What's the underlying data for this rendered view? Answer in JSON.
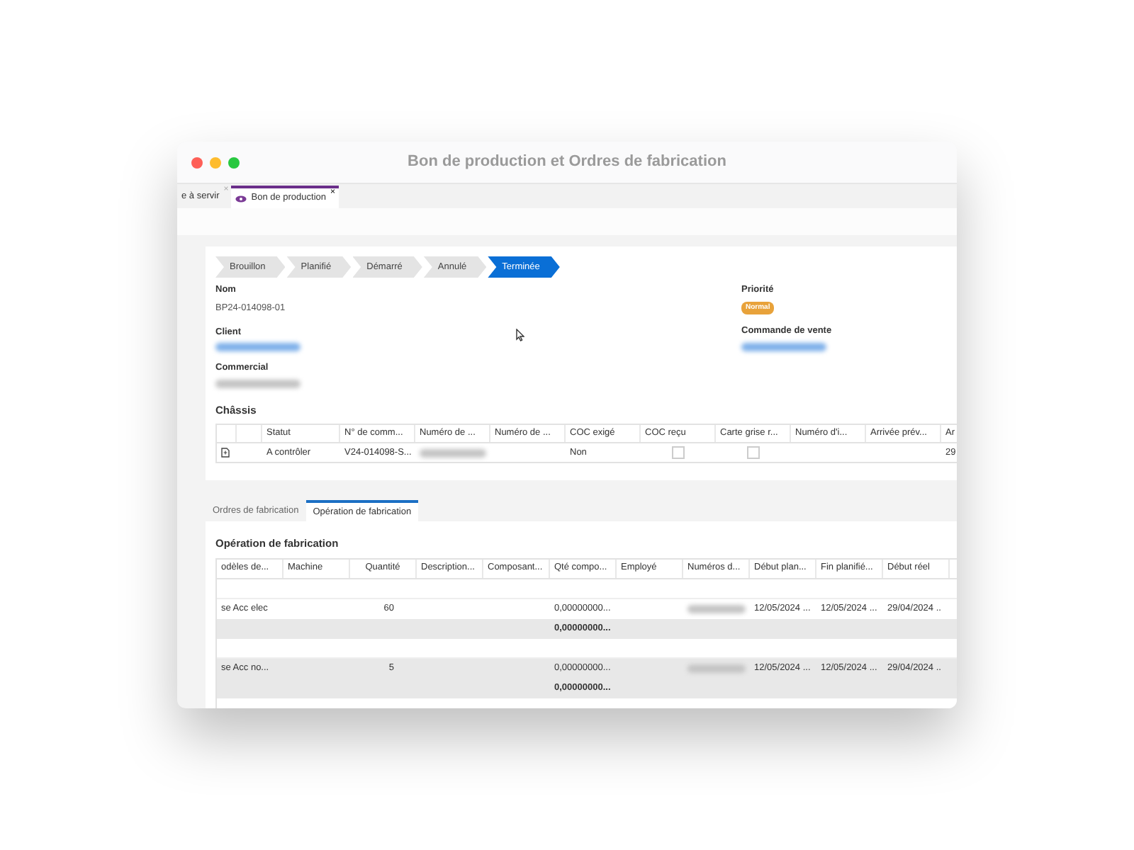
{
  "window": {
    "title": "Bon de production et Ordres de fabrication"
  },
  "tabs": [
    {
      "label": "e à servir",
      "selected": false,
      "close": "×"
    },
    {
      "label": "Bon de production",
      "selected": true,
      "close": "×"
    }
  ],
  "stepper": [
    {
      "label": "Brouillon",
      "selected": false
    },
    {
      "label": "Planifié",
      "selected": false
    },
    {
      "label": "Démarré",
      "selected": false
    },
    {
      "label": "Annulé",
      "selected": false
    },
    {
      "label": "Terminée",
      "selected": true
    }
  ],
  "fields_left": [
    {
      "label": "Nom",
      "kind": "text",
      "value": "BP24-014098-01"
    },
    {
      "label": "Client",
      "kind": "link-blurred"
    },
    {
      "label": "Commercial",
      "kind": "blurred"
    }
  ],
  "fields_right": [
    {
      "label": "Priorité",
      "kind": "badge",
      "value": "Normal"
    },
    {
      "label": "Commande de vente",
      "kind": "link-blurred"
    }
  ],
  "chassis": {
    "title": "Châssis",
    "columns": [
      "",
      "",
      "Statut",
      "N° de comm...",
      "Numéro de ...",
      "Numéro de ...",
      "COC exigé",
      "COC reçu",
      "Carte grise r...",
      "Numéro d'i...",
      "Arrivée prév...",
      "Ar"
    ],
    "rows": [
      [
        {
          "kind": "icon"
        },
        {
          "kind": "text"
        },
        {
          "kind": "text",
          "value": "A contrôler"
        },
        {
          "kind": "text",
          "value": "V24-014098-S..."
        },
        {
          "kind": "blurred"
        },
        {
          "kind": "text"
        },
        {
          "kind": "text",
          "value": "Non"
        },
        {
          "kind": "checkbox",
          "checked": false
        },
        {
          "kind": "checkbox",
          "checked": false
        },
        {
          "kind": "text"
        },
        {
          "kind": "text"
        },
        {
          "kind": "text",
          "value": "29"
        }
      ]
    ]
  },
  "lower_tabs": [
    {
      "label": "Ordres de fabrication",
      "selected": false
    },
    {
      "label": "Opération de fabrication",
      "selected": true
    }
  ],
  "operations": {
    "title": "Opération de fabrication",
    "columns": [
      "odèles de...",
      "Machine",
      "Quantité",
      "Description...",
      "Composant...",
      "Qté compo...",
      "Employé",
      "Numéros d...",
      "Début plan...",
      "Fin planifié...",
      "Début réel"
    ],
    "rows": [
      {
        "kind": "empty"
      },
      {
        "kind": "data",
        "cells": [
          "se Acc elec",
          "",
          "60",
          "",
          "",
          "0,00000000...",
          "",
          null,
          "12/05/2024 ...",
          "12/05/2024 ...",
          "29/04/2024 .."
        ]
      },
      {
        "kind": "subtotal",
        "cells": [
          "",
          "",
          "",
          "",
          "",
          "0,00000000...",
          "",
          "",
          "",
          "",
          ""
        ]
      },
      {
        "kind": "empty"
      },
      {
        "kind": "data",
        "cells": [
          "se Acc no...",
          "",
          "5",
          "",
          "",
          "0,00000000...",
          "",
          null,
          "12/05/2024 ...",
          "12/05/2024 ...",
          "29/04/2024 .."
        ]
      },
      {
        "kind": "subtotal",
        "cells": [
          "",
          "",
          "",
          "",
          "",
          "0,00000000...",
          "",
          "",
          "",
          "",
          ""
        ]
      }
    ]
  }
}
